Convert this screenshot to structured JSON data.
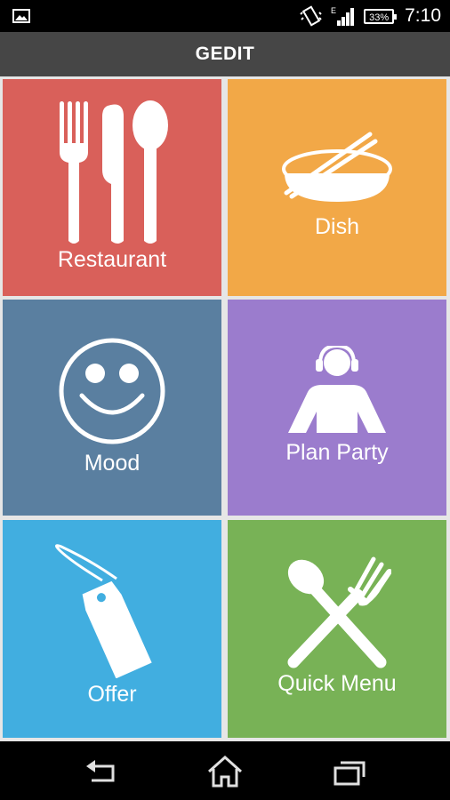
{
  "status_bar": {
    "battery_percent": "33%",
    "time": "7:10",
    "network_type": "E",
    "icons": [
      "image-notification-icon",
      "vibrate-icon",
      "signal-icon",
      "battery-icon"
    ]
  },
  "app_bar": {
    "title": "GEDIT"
  },
  "tiles": [
    {
      "label": "Restaurant",
      "icon": "cutlery-icon",
      "color": "#d9605a"
    },
    {
      "label": "Dish",
      "icon": "bowl-chopsticks-icon",
      "color": "#f2a847"
    },
    {
      "label": "Mood",
      "icon": "smiley-icon",
      "color": "#5a7fa0"
    },
    {
      "label": "Plan Party",
      "icon": "dj-person-icon",
      "color": "#9b7ccd"
    },
    {
      "label": "Offer",
      "icon": "price-tag-icon",
      "color": "#41aee0"
    },
    {
      "label": "Quick Menu",
      "icon": "crossed-spoon-fork-icon",
      "color": "#78b256"
    }
  ],
  "nav_bar": {
    "back": "back-icon",
    "home": "home-icon",
    "recents": "recents-icon"
  }
}
